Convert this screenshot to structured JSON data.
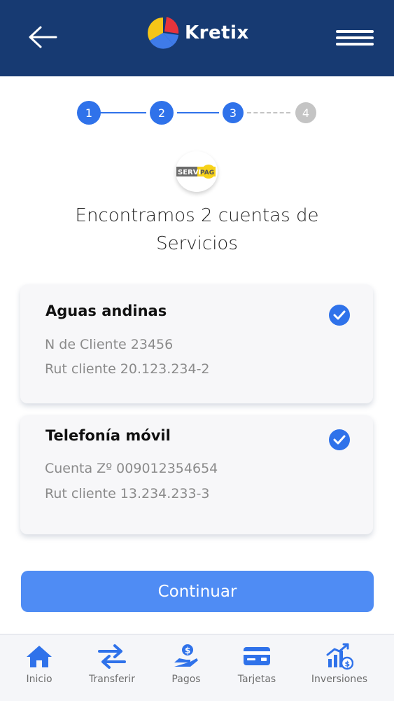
{
  "header": {
    "brand": "Kretix",
    "back_icon": "arrow-left-icon",
    "menu_icon": "hamburger-menu-icon",
    "bg_color": "#173a72"
  },
  "stepper": {
    "steps": [
      "1",
      "2",
      "3",
      "4"
    ],
    "current_step": 3,
    "active_color": "#2f72ea",
    "inactive_color": "#c4c4c4"
  },
  "provider": {
    "logo_text_left": "SERVI",
    "logo_text_right": "PAG"
  },
  "headline": {
    "line1": "Encontramos 2 cuentas de",
    "line2": "Servicios"
  },
  "accounts": [
    {
      "title": "Aguas andinas",
      "line1": "N de Cliente 23456",
      "line2": "Rut cliente 20.123.234-2",
      "selected": true
    },
    {
      "title": "Telefonía móvil",
      "line1": "Cuenta Zº 009012354654",
      "line2": "Rut cliente 13.234.233-3",
      "selected": true
    }
  ],
  "continue_label": "Continuar",
  "bottom_nav": [
    {
      "label": "Inicio",
      "icon": "home-icon"
    },
    {
      "label": "Transferir",
      "icon": "transfer-arrows-icon"
    },
    {
      "label": "Pagos",
      "icon": "payment-hand-icon"
    },
    {
      "label": "Tarjetas",
      "icon": "credit-card-icon"
    },
    {
      "label": "Inversiones",
      "icon": "investments-chart-icon"
    }
  ],
  "accent_color": "#2f72ea"
}
